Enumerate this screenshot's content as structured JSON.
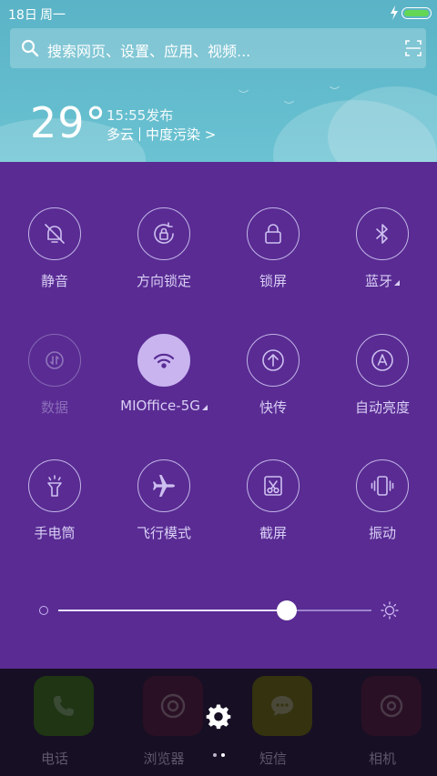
{
  "status_bar": {
    "date": "18日",
    "weekday": "周一",
    "icons": [
      "charging-icon",
      "battery-icon"
    ],
    "battery_color": "#63d655"
  },
  "search": {
    "placeholder": "搜索网页、设置、应用、视频...",
    "icons": [
      "search-icon",
      "scan-icon"
    ]
  },
  "weather": {
    "temperature": "29°",
    "publish_time": "15:55发布",
    "condition": "多云",
    "pollution": "中度污染 >"
  },
  "toggles": [
    {
      "label": "静音",
      "icon": "bell-off-icon",
      "state": "normal"
    },
    {
      "label": "方向锁定",
      "icon": "rotation-lock-icon",
      "state": "normal"
    },
    {
      "label": "锁屏",
      "icon": "lock-icon",
      "state": "normal"
    },
    {
      "label": "蓝牙",
      "icon": "bluetooth-icon",
      "state": "normal",
      "has_more": true
    },
    {
      "label": "数据",
      "icon": "mobile-data-icon",
      "state": "disabled"
    },
    {
      "label": "MIOffice-5G",
      "icon": "wifi-icon",
      "state": "active",
      "has_more": true
    },
    {
      "label": "快传",
      "icon": "transfer-icon",
      "state": "normal"
    },
    {
      "label": "自动亮度",
      "icon": "auto-brightness-icon",
      "state": "normal"
    },
    {
      "label": "手电筒",
      "icon": "flashlight-icon",
      "state": "normal"
    },
    {
      "label": "飞行模式",
      "icon": "airplane-icon",
      "state": "normal"
    },
    {
      "label": "截屏",
      "icon": "screenshot-icon",
      "state": "normal"
    },
    {
      "label": "振动",
      "icon": "vibrate-icon",
      "state": "normal"
    }
  ],
  "brightness": {
    "level": 0.73
  },
  "dock": {
    "apps": [
      {
        "label": "电话",
        "icon": "phone-icon",
        "color": "#1f3514"
      },
      {
        "label": "浏览器",
        "icon": "browser-icon",
        "color": "#2a1024"
      },
      {
        "label": "短信",
        "icon": "message-icon",
        "color": "#34320f"
      },
      {
        "label": "相机",
        "icon": "camera-icon",
        "color": "#2a1024"
      }
    ]
  },
  "colors": {
    "panel": "#592b93",
    "header": "#5ab3c6",
    "active_toggle": "#c9b4ef"
  }
}
